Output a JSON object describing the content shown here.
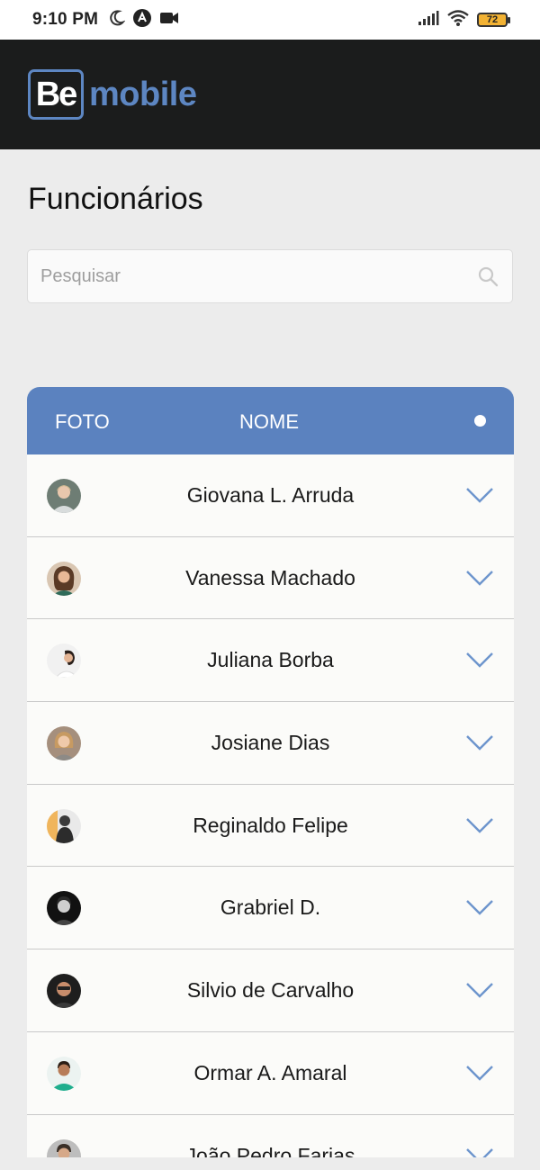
{
  "status_bar": {
    "time": "9:10 PM",
    "battery": "72"
  },
  "header": {
    "logo_be": "Be",
    "logo_word": "mobile"
  },
  "page": {
    "title": "Funcionários"
  },
  "search": {
    "placeholder": "Pesquisar",
    "value": ""
  },
  "table": {
    "columns": {
      "foto": "FOTO",
      "nome": "NOME"
    },
    "rows": [
      {
        "name": "Giovana L. Arruda"
      },
      {
        "name": "Vanessa Machado"
      },
      {
        "name": "Juliana Borba"
      },
      {
        "name": "Josiane Dias"
      },
      {
        "name": "Reginaldo Felipe"
      },
      {
        "name": "Grabriel D."
      },
      {
        "name": "Silvio de Carvalho"
      },
      {
        "name": "Ormar A. Amaral"
      },
      {
        "name": "João Pedro Farias"
      }
    ]
  },
  "colors": {
    "accent": "#5b82bf",
    "appbar": "#1b1c1c",
    "background": "#ececec"
  }
}
